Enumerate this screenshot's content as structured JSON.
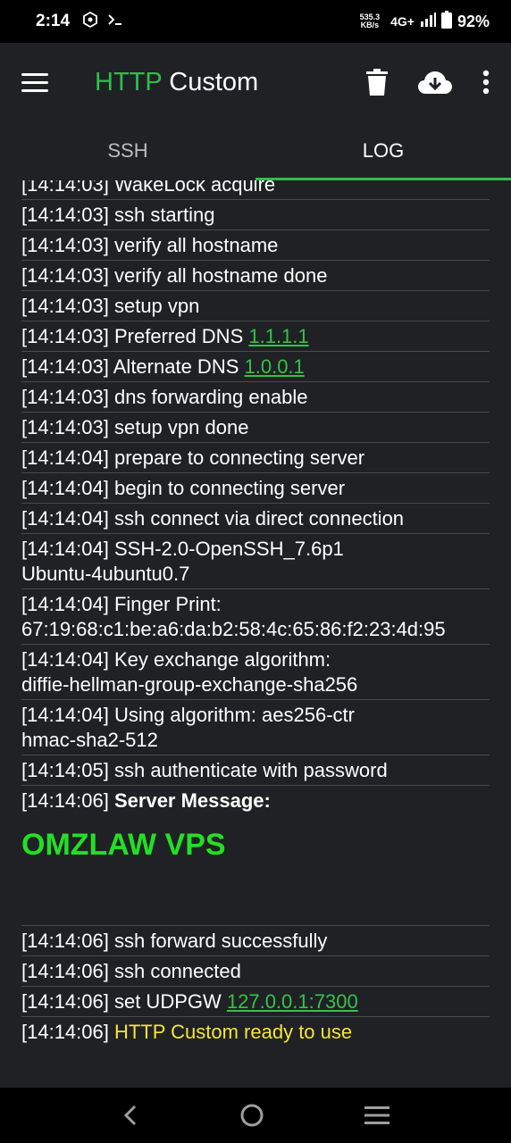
{
  "status_bar": {
    "time": "2:14",
    "net_speed_value": "535.3",
    "net_speed_unit": "KB/s",
    "network": "4G+",
    "battery": "92%"
  },
  "app_bar": {
    "title_part1": "HTTP",
    "title_part2": "Custom",
    "icons": [
      "menu-icon",
      "trash-icon",
      "cloud-download-icon",
      "more-vert-icon"
    ]
  },
  "tabs": [
    {
      "label": "SSH"
    },
    {
      "label": "LOG"
    }
  ],
  "log": {
    "partial_top": "[14:14:03] WakeLock acquire",
    "entries": [
      {
        "text": "[14:14:03] ssh starting"
      },
      {
        "text": "[14:14:03] verify all hostname"
      },
      {
        "text": "[14:14:03] verify all hostname done"
      },
      {
        "text": "[14:14:03] setup vpn"
      },
      {
        "text": "[14:14:03] Preferred DNS ",
        "link": "1.1.1.1"
      },
      {
        "text": "[14:14:03] Alternate DNS ",
        "link": "1.0.0.1"
      },
      {
        "text": "[14:14:03] dns forwarding enable"
      },
      {
        "text": "[14:14:03] setup vpn done"
      },
      {
        "text": "[14:14:04] prepare to connecting server"
      },
      {
        "text": "[14:14:04] begin to connecting server"
      },
      {
        "text": "[14:14:04] ssh connect via direct connection"
      },
      {
        "line1": "[14:14:04] SSH-2.0-OpenSSH_7.6p1",
        "line2": "Ubuntu-4ubuntu0.7"
      },
      {
        "line1": "[14:14:04] Finger Print:",
        "line2": "67:19:68:c1:be:a6:da:b2:58:4c:65:86:f2:23:4d:95"
      },
      {
        "line1": "[14:14:04] Key exchange algorithm:",
        "line2": "diffie-hellman-group-exchange-sha256"
      },
      {
        "line1": "[14:14:04] Using algorithm: aes256-ctr",
        "line2": "hmac-sha2-512"
      },
      {
        "text": "[14:14:05] ssh authenticate with password"
      }
    ],
    "server_message_prefix": "[14:14:06] ",
    "server_message_label": "Server Message:",
    "server_banner": "OMZLAW VPS",
    "after": [
      {
        "text": "[14:14:06] ssh forward successfully"
      },
      {
        "text": "[14:14:06] ssh connected"
      },
      {
        "text": "[14:14:06] set UDPGW ",
        "link": "127.0.0.1:7300"
      }
    ],
    "ready_prefix": "[14:14:06] ",
    "ready_text": "HTTP Custom ready to use"
  },
  "nav_bar": {
    "icons": [
      "back-icon",
      "home-icon",
      "recents-icon"
    ]
  },
  "colors": {
    "accent_green": "#2fbf4a",
    "banner_green": "#22e024",
    "ready_yellow": "#f4e53a",
    "background": "#202124"
  }
}
